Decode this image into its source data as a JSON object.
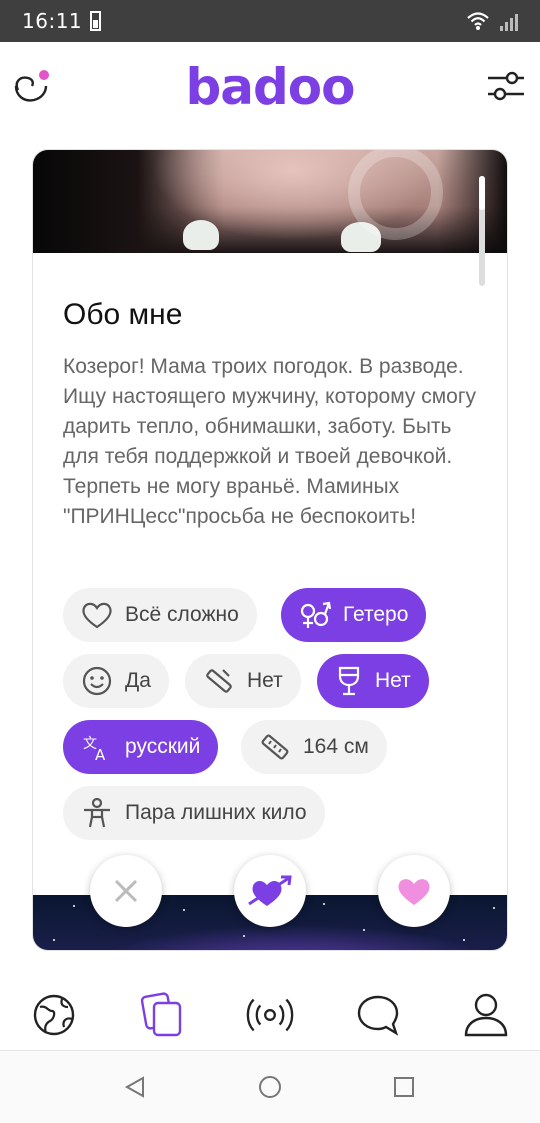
{
  "status_bar": {
    "time": "16:11"
  },
  "app": {
    "logo": "badoo"
  },
  "profile": {
    "about_title": "Обо мне",
    "about_text": "Козерог! Мама троих погодок. В разводе. Ищу настоящего мужчину, которому смогу дарить тепло, обнимашки, заботу. Быть для тебя поддержкой и твоей девочкой. Терпеть не могу враньё. Маминых \"ПРИНЦесс\"просьба не беспокоить!",
    "chips": [
      {
        "label": "Всё сложно",
        "icon": "heart-outline-icon",
        "highlighted": false
      },
      {
        "label": "Гетеро",
        "icon": "gender-icon",
        "highlighted": true
      },
      {
        "label": "Да",
        "icon": "smile-icon",
        "highlighted": false
      },
      {
        "label": "Нет",
        "icon": "cigarette-icon",
        "highlighted": false
      },
      {
        "label": "Нет",
        "icon": "wine-glass-icon",
        "highlighted": true
      },
      {
        "label": "русский",
        "icon": "translate-icon",
        "highlighted": true
      },
      {
        "label": "164 см",
        "icon": "ruler-icon",
        "highlighted": false
      },
      {
        "label": "Пара лишних кило",
        "icon": "body-icon",
        "highlighted": false
      }
    ]
  },
  "actions": {
    "dislike": "close-icon",
    "crush": "heart-arrow-icon",
    "like": "heart-icon"
  },
  "tabs": [
    "globe-icon",
    "cards-icon",
    "broadcast-icon",
    "chat-icon",
    "profile-icon"
  ],
  "colors": {
    "accent": "#7b3fe4",
    "like": "#f08ee0",
    "chip_bg": "#f2f2f2"
  }
}
